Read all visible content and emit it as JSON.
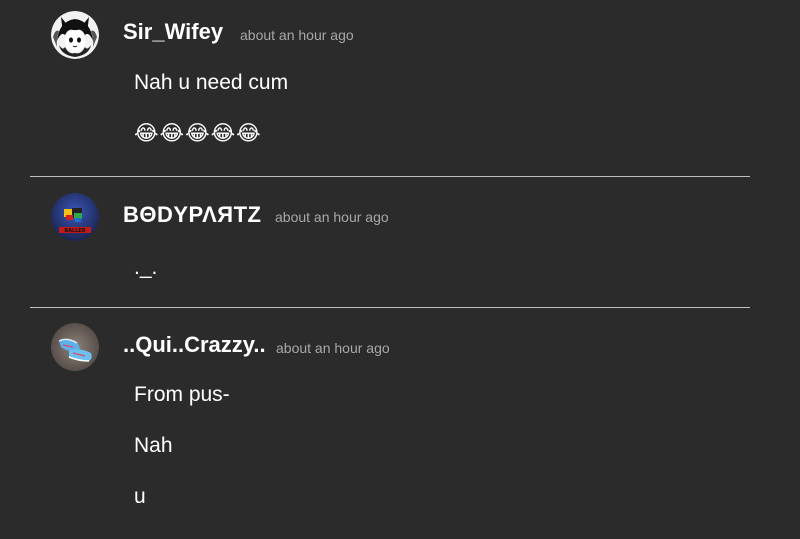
{
  "comments": [
    {
      "username": "Sir_Wifey",
      "timestamp": "about an hour ago",
      "lines": [
        "Nah u need cum"
      ],
      "emoji": "😂😂😂😂😂",
      "avatar_icon": "anime-character-avatar"
    },
    {
      "username": "ΒΘDΥΡΛЯΤΖ",
      "timestamp": "about an hour ago",
      "lines": [
        "._."
      ],
      "avatar_icon": "roblox-baller-avatar"
    },
    {
      "username": "..Qui..Crazzy..",
      "timestamp": "about an hour ago",
      "lines": [
        "From pus-",
        "Nah",
        "u"
      ],
      "avatar_icon": "blue-sneakers-avatar"
    }
  ],
  "colors": {
    "background": "#2b2b2b",
    "text": "#ffffff",
    "timestamp": "#a8a8a8",
    "divider": "#bdbdbd"
  }
}
